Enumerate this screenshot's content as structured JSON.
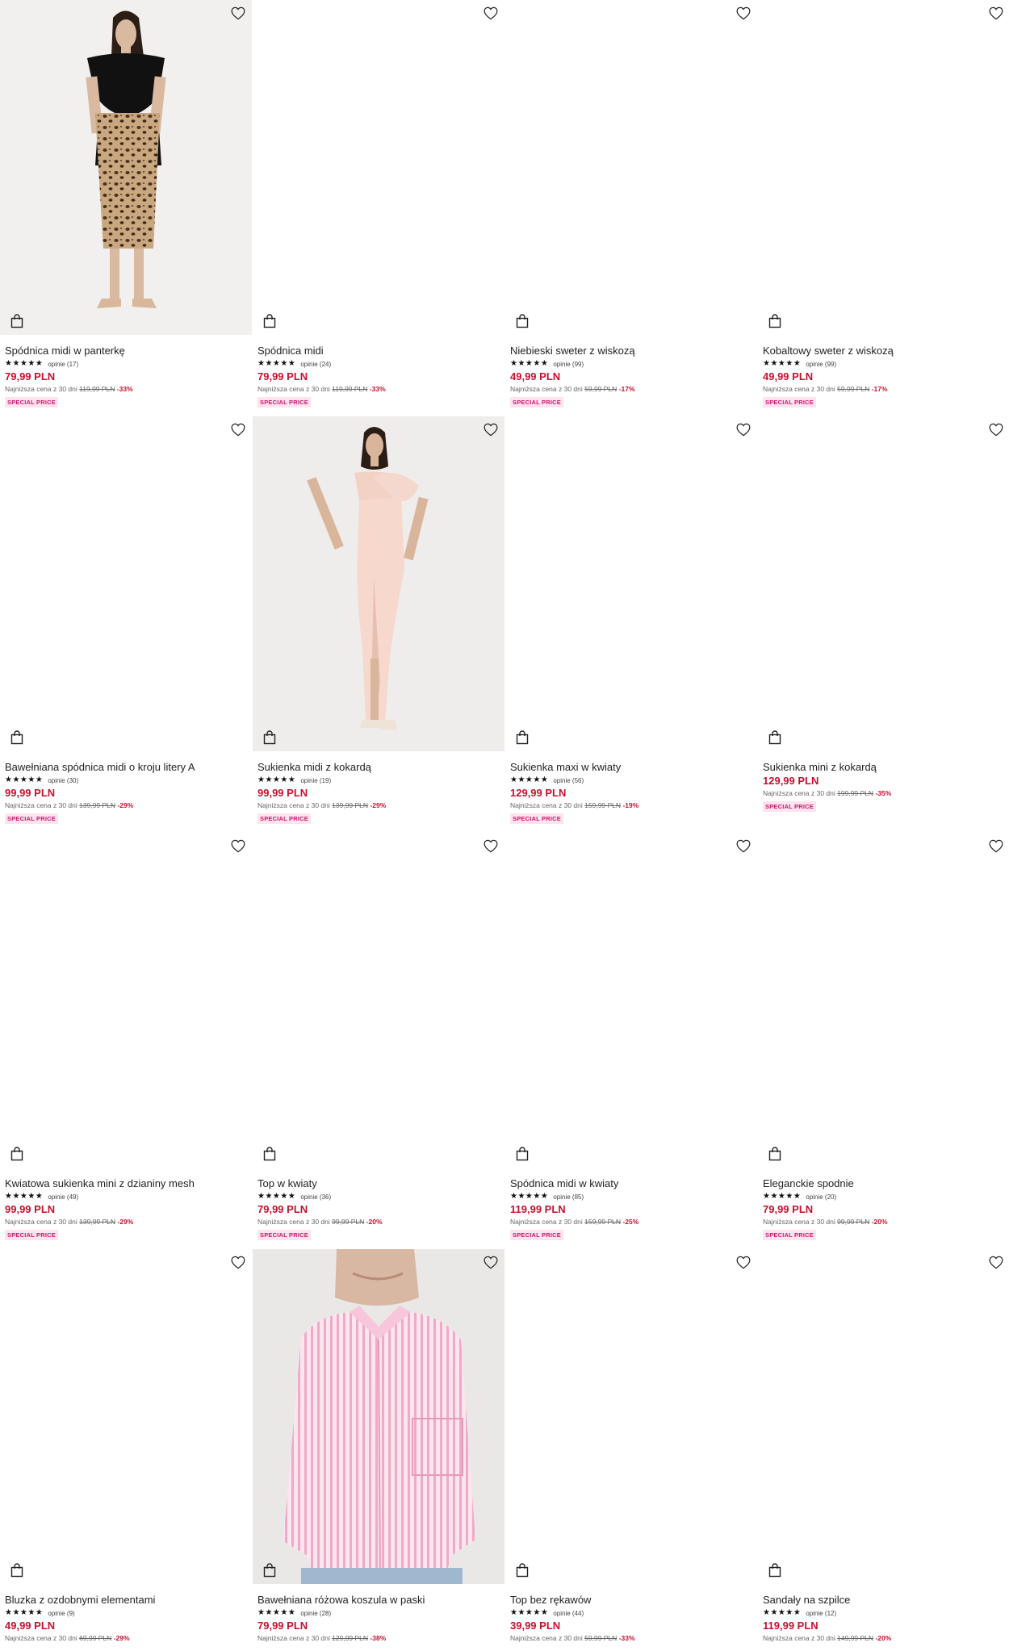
{
  "products": [
    {
      "name": "Spódnica midi w panterkę",
      "stars": "★★★★★",
      "reviews": "opinie (17)",
      "price": "79,99 PLN",
      "lowest_prefix": "Najniższa cena z 30 dni",
      "old_price": "119,99 PLN",
      "discount": "-33%",
      "badge": "SPECIAL PRICE",
      "photo": "leopard-skirt"
    },
    {
      "name": "Spódnica midi",
      "stars": "★★★★★",
      "reviews": "opinie (24)",
      "price": "79,99 PLN",
      "lowest_prefix": "Najniższa cena z 30 dni",
      "old_price": "119,99 PLN",
      "discount": "-33%",
      "badge": "SPECIAL PRICE",
      "photo": ""
    },
    {
      "name": "Niebieski sweter z wiskozą",
      "stars": "★★★★★",
      "reviews": "opinie (99)",
      "price": "49,99 PLN",
      "lowest_prefix": "Najniższa cena z 30 dni",
      "old_price": "59,99 PLN",
      "discount": "-17%",
      "badge": "SPECIAL PRICE",
      "photo": ""
    },
    {
      "name": "Kobaltowy sweter z wiskozą",
      "stars": "★★★★★",
      "reviews": "opinie (99)",
      "price": "49,99 PLN",
      "lowest_prefix": "Najniższa cena z 30 dni",
      "old_price": "59,99 PLN",
      "discount": "-17%",
      "badge": "SPECIAL PRICE",
      "photo": ""
    },
    {
      "name": "Bawełniana spódnica midi o kroju litery A",
      "stars": "★★★★★",
      "reviews": "opinie (30)",
      "price": "99,99 PLN",
      "lowest_prefix": "Najniższa cena z 30 dni",
      "old_price": "139,99 PLN",
      "discount": "-29%",
      "badge": "SPECIAL PRICE",
      "photo": ""
    },
    {
      "name": "Sukienka midi z kokardą",
      "stars": "★★★★★",
      "reviews": "opinie (19)",
      "price": "99,99 PLN",
      "lowest_prefix": "Najniższa cena z 30 dni",
      "old_price": "139,99 PLN",
      "discount": "-29%",
      "badge": "SPECIAL PRICE",
      "photo": "pink-dress"
    },
    {
      "name": "Sukienka maxi w kwiaty",
      "stars": "★★★★★",
      "reviews": "opinie (56)",
      "price": "129,99 PLN",
      "lowest_prefix": "Najniższa cena z 30 dni",
      "old_price": "159,99 PLN",
      "discount": "-19%",
      "badge": "SPECIAL PRICE",
      "photo": ""
    },
    {
      "name": "Sukienka mini z kokardą",
      "stars": "",
      "reviews": "",
      "price": "129,99 PLN",
      "lowest_prefix": "Najniższa cena z 30 dni",
      "old_price": "199,99 PLN",
      "discount": "-35%",
      "badge": "SPECIAL PRICE",
      "photo": ""
    },
    {
      "name": "Kwiatowa sukienka mini z dzianiny mesh",
      "stars": "★★★★★",
      "reviews": "opinie (49)",
      "price": "99,99 PLN",
      "lowest_prefix": "Najniższa cena z 30 dni",
      "old_price": "139,99 PLN",
      "discount": "-29%",
      "badge": "SPECIAL PRICE",
      "photo": ""
    },
    {
      "name": "Top w kwiaty",
      "stars": "★★★★★",
      "reviews": "opinie (36)",
      "price": "79,99 PLN",
      "lowest_prefix": "Najniższa cena z 30 dni",
      "old_price": "99,99 PLN",
      "discount": "-20%",
      "badge": "SPECIAL PRICE",
      "photo": ""
    },
    {
      "name": "Spódnica midi w kwiaty",
      "stars": "★★★★★",
      "reviews": "opinie (85)",
      "price": "119,99 PLN",
      "lowest_prefix": "Najniższa cena z 30 dni",
      "old_price": "159,99 PLN",
      "discount": "-25%",
      "badge": "SPECIAL PRICE",
      "photo": ""
    },
    {
      "name": "Eleganckie spodnie",
      "stars": "★★★★★",
      "reviews": "opinie (20)",
      "price": "79,99 PLN",
      "lowest_prefix": "Najniższa cena z 30 dni",
      "old_price": "99,99 PLN",
      "discount": "-20%",
      "badge": "SPECIAL PRICE",
      "photo": ""
    },
    {
      "name": "Bluzka z ozdobnymi elementami",
      "stars": "★★★★★",
      "reviews": "opinie (9)",
      "price": "49,99 PLN",
      "lowest_prefix": "Najniższa cena z 30 dni",
      "old_price": "69,99 PLN",
      "discount": "-29%",
      "badge": "",
      "photo": ""
    },
    {
      "name": "Bawełniana różowa koszula w paski",
      "stars": "★★★★★",
      "reviews": "opinie (28)",
      "price": "79,99 PLN",
      "lowest_prefix": "Najniższa cena z 30 dni",
      "old_price": "129,99 PLN",
      "discount": "-38%",
      "badge": "",
      "photo": "pink-shirt"
    },
    {
      "name": "Top bez rękawów",
      "stars": "★★★★★",
      "reviews": "opinie (44)",
      "price": "39,99 PLN",
      "lowest_prefix": "Najniższa cena z 30 dni",
      "old_price": "59,99 PLN",
      "discount": "-33%",
      "badge": "",
      "photo": ""
    },
    {
      "name": "Sandały na szpilce",
      "stars": "★★★★★",
      "reviews": "opinie (12)",
      "price": "119,99 PLN",
      "lowest_prefix": "Najniższa cena z 30 dni",
      "old_price": "149,99 PLN",
      "discount": "-20%",
      "badge": "",
      "photo": ""
    }
  ],
  "icons": {
    "favorite": "heart-outline-icon",
    "cart": "shopping-bag-icon"
  },
  "colors": {
    "price": "#c8102e",
    "badge_bg": "#fde4ef",
    "badge_text": "#d1156b"
  }
}
